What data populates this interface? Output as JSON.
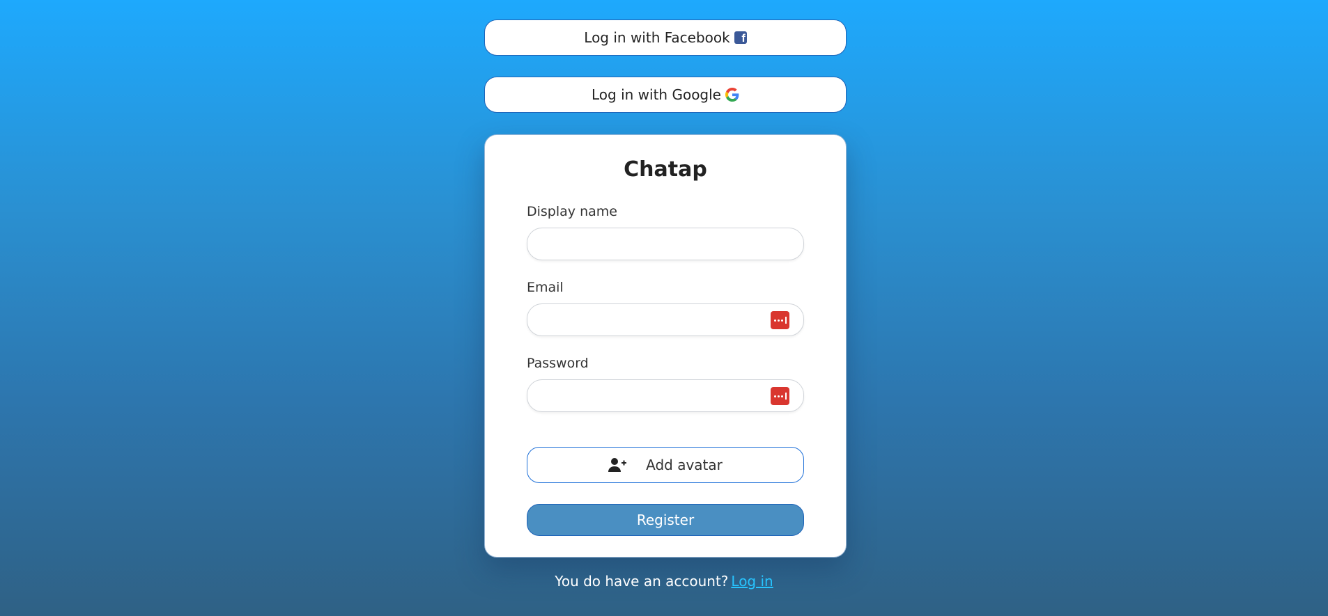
{
  "social": {
    "facebook_label": "Log in with Facebook",
    "facebook_icon": "facebook-icon",
    "google_label": "Log in with Google",
    "google_icon": "google-icon"
  },
  "form": {
    "title": "Chatap",
    "display_name_label": "Display name",
    "display_name_value": "",
    "email_label": "Email",
    "email_value": "",
    "password_label": "Password",
    "password_value": "",
    "password_manager_icon": "password-manager-icon",
    "avatar_label": "Add avatar",
    "avatar_icon": "add-user-icon",
    "register_label": "Register"
  },
  "footer": {
    "prompt": "You do have an account?",
    "login_link": "Log in"
  },
  "colors": {
    "background_top": "#1ea9fd",
    "background_bottom": "#2f6185",
    "register_button": "#4a8fc2",
    "button_border": "#1d63b8",
    "password_manager": "#d9362f",
    "link": "#27c4ff"
  }
}
